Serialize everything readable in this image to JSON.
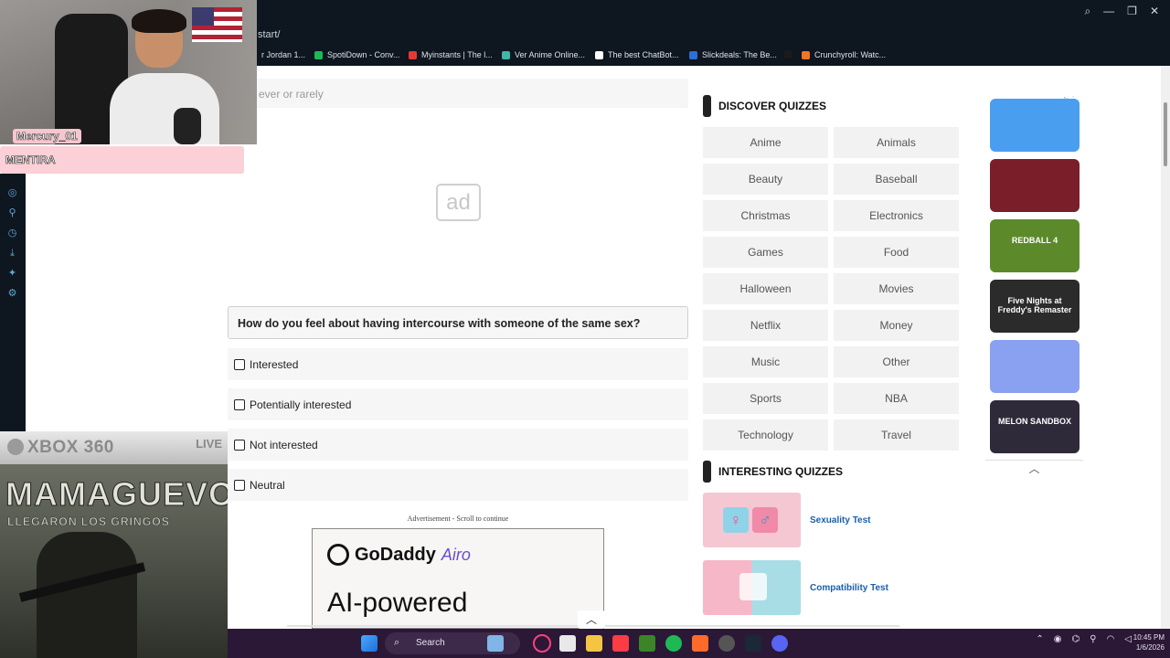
{
  "browser": {
    "url": "start/",
    "bookmarks": [
      {
        "label": "r Jordan 1...",
        "color": "#333333"
      },
      {
        "label": "SpotiDown - Conv...",
        "color": "#1db954"
      },
      {
        "label": "Myinstants | The l...",
        "color": "#e53935"
      },
      {
        "label": "Ver Anime Online...",
        "color": "#3fb6a8"
      },
      {
        "label": "The best ChatBot...",
        "color": "#ffffff"
      },
      {
        "label": "Slickdeals: The Be...",
        "color": "#2c6fd6"
      },
      {
        "label": "",
        "color": "#1a1a1a"
      },
      {
        "label": "Crunchyroll: Watc...",
        "color": "#f47521"
      }
    ]
  },
  "stream": {
    "name_tag": "Mercury_01",
    "status": "MENTIRA",
    "xbox_brand": "XBOX 360",
    "xbox_live": "LIVE",
    "overlay_title": "MAMAGUEVO",
    "overlay_subtitle": "LLEGARON LOS GRINGOS"
  },
  "quiz": {
    "previous_answer": "ever or rarely",
    "ad_placeholder": "ad",
    "question": "How do you feel about having intercourse with someone of the same sex?",
    "options": [
      "Interested",
      "Potentially interested",
      "Not interested",
      "Neutral"
    ],
    "advertisement_label": "Advertisement - Scroll to continue",
    "ad_brand": "GoDaddy",
    "ad_brand_suffix": "Airo",
    "ad_tagline": "AI-powered"
  },
  "discover": {
    "heading": "DISCOVER QUIZZES",
    "categories": [
      "Anime",
      "Animals",
      "Beauty",
      "Baseball",
      "Christmas",
      "Electronics",
      "Games",
      "Food",
      "Halloween",
      "Movies",
      "Netflix",
      "Money",
      "Music",
      "Other",
      "Sports",
      "NBA",
      "Technology",
      "Travel"
    ]
  },
  "interesting": {
    "heading": "INTERESTING QUIZZES",
    "quizzes": [
      {
        "title": "Sexuality Test",
        "color": "#f4c7d3"
      },
      {
        "title": "Compatibility Test",
        "color": "#a9dde6"
      }
    ]
  },
  "games": [
    {
      "label": "",
      "color": "#4a9ef0"
    },
    {
      "label": "",
      "color": "#7a1f2a"
    },
    {
      "label": "REDBALL 4",
      "color": "#5c8a2a"
    },
    {
      "label": "Five Nights at Freddy's Remaster",
      "color": "#2b2b2b"
    },
    {
      "label": "",
      "color": "#8aa0f0"
    },
    {
      "label": "MELON SANDBOX",
      "color": "#2f2a3a"
    }
  ],
  "taskbar": {
    "search_label": "Search",
    "time": "10:45 PM",
    "date": "1/6/2026"
  },
  "colors": {
    "page_bg": "#ffffff",
    "accent_link": "#1a5fa8",
    "taskbar": "#2a1836"
  }
}
